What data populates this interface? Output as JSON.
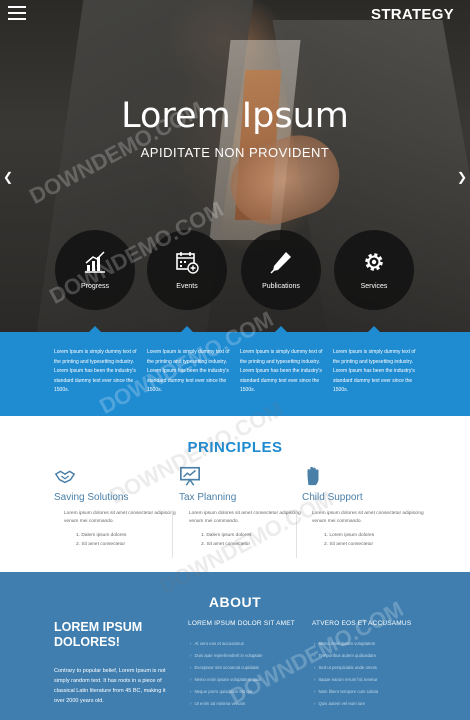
{
  "header": {
    "brand": "STRATEGY",
    "menu_icon": "hamburger-menu-icon"
  },
  "hero": {
    "title": "Lorem Ipsum",
    "subtitle": "APIDITATE NON PROVIDENT",
    "prev_icon": "chevron-left-icon",
    "next_icon": "chevron-right-icon"
  },
  "features": [
    {
      "label": "Progress",
      "icon": "chart-icon"
    },
    {
      "label": "Events",
      "icon": "calendar-icon"
    },
    {
      "label": "Publications",
      "icon": "pen-icon"
    },
    {
      "label": "Services",
      "icon": "gear-icon"
    }
  ],
  "band": [
    {
      "text": "Lorem Ipsum is simply dummy text of the printing and typesetting industry. Lorem Ipsum has been the industry's standard dummy text ever since the 1500s."
    },
    {
      "text": "Lorem Ipsum is simply dummy text of the printing and typesetting industry. Lorem Ipsum has been the industry's standard dummy text ever since the 1500s."
    },
    {
      "text": "Lorem Ipsum is simply dummy text of the printing and typesetting industry. Lorem Ipsum has been the industry's standard dummy text ever since the 1500s."
    },
    {
      "text": "Lorem Ipsum is simply dummy text of the printing and typesetting industry. Lorem Ipsum has been the industry's standard dummy text ever since the 1500s."
    }
  ],
  "principles": {
    "title": "PRINCIPLES",
    "items": [
      {
        "heading": "Saving Solutions",
        "icon": "handshake-icon",
        "text": "Lorem ipsum dolores sit amet consectetur adipiscing venum mei commando.",
        "list": [
          "1. Dalem ipsum dolores",
          "2. Sit amet consectetur"
        ]
      },
      {
        "heading": "Tax Planning",
        "icon": "presentation-board-icon",
        "text": "Lorem ipsum dolores sit amet consectetur adipiscing venum mei commando.",
        "list": [
          "1. Dalem ipsum dolores",
          "2. Sit amet consectetur"
        ]
      },
      {
        "heading": "Child Support",
        "icon": "hand-icon",
        "text": "Lorem ipsum dolores sit amet consectetur adipiscing venum mei commando.",
        "list": [
          "1. Lorem ipsum dolores",
          "2. Sit amet consectetur"
        ]
      }
    ]
  },
  "about": {
    "title": "ABOUT",
    "heading": "LOREM IPSUM DOLORES!",
    "text": "Contrary to popular belief, Lorem Ipsum is not simply random text. It has roots in a piece of classical Latin literature from 45 BC, making it over 2000 years old.",
    "col1_title": "LOREM IPSUM DOLOR SIT AMET",
    "col1_items": [
      "At vero eos et accusamus",
      "Duis aute reprehenderit in voluptate",
      "Excepteur sint occaecat cupidatat",
      "Nemo enim ipsam voluptatem quia",
      "Neque porro quisquam est qui",
      "Ut enim ad minima veniam"
    ],
    "col2_title": "ATVERO EOS ET ACCUSAMUS",
    "col2_items": [
      "Nemo enim ipsam voluptatem",
      "Temporibus autem quibusdam",
      "Sed ut perspiciatis unde omnis",
      "Itaque earum rerum hic tenetur",
      "Nam libero tempore cum soluta",
      "Quis autem vel eum iure"
    ]
  },
  "watermark": "DOWNDEMO.COM",
  "colors": {
    "accent": "#1f8bd1",
    "about_bg": "#3f7eaf",
    "principle_head": "#4a7fa8"
  }
}
